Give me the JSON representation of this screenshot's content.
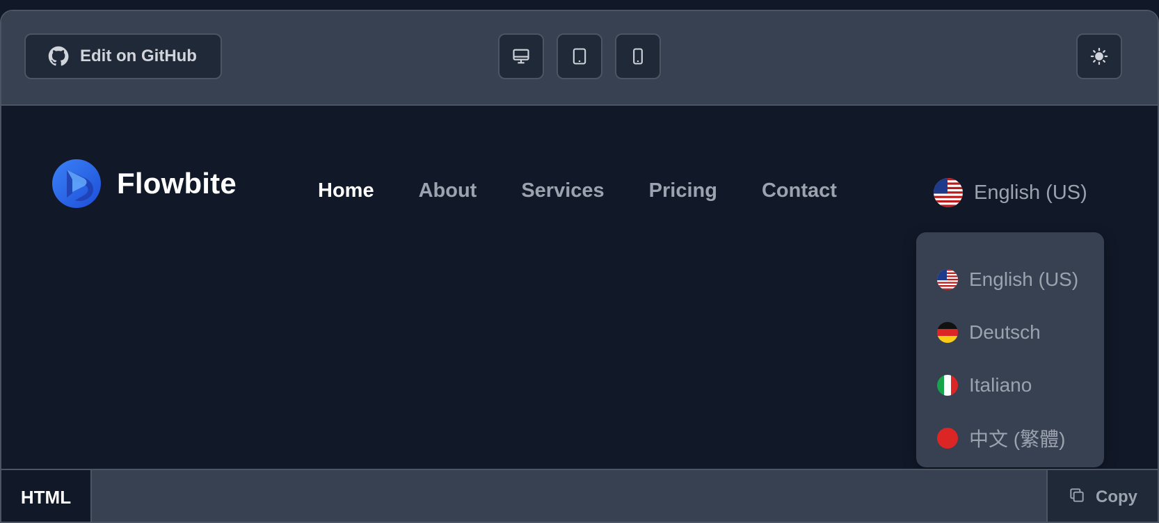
{
  "toolbar": {
    "github_label": "Edit on GitHub",
    "icons": {
      "github": "github-icon",
      "desktop": "desktop-icon",
      "tablet": "tablet-icon",
      "mobile": "mobile-icon",
      "theme": "sun-icon"
    }
  },
  "navbar": {
    "brand": "Flowbite",
    "links": [
      {
        "label": "Home",
        "active": true
      },
      {
        "label": "About",
        "active": false
      },
      {
        "label": "Services",
        "active": false
      },
      {
        "label": "Pricing",
        "active": false
      },
      {
        "label": "Contact",
        "active": false
      }
    ],
    "language": {
      "selected": "English (US)",
      "selected_flag": "us-flag",
      "options": [
        {
          "label": "English (US)",
          "flag": "us-flag"
        },
        {
          "label": "Deutsch",
          "flag": "de-flag"
        },
        {
          "label": "Italiano",
          "flag": "it-flag"
        },
        {
          "label": "中文 (繁體)",
          "flag": "cn-flag"
        }
      ]
    }
  },
  "footer": {
    "tab_label": "HTML",
    "copy_label": "Copy",
    "copy_icon": "copy-icon"
  },
  "colors": {
    "page_bg": "#111827",
    "toolbar_bg": "#374151",
    "button_bg": "#1f2937",
    "border": "#4b5563",
    "text_muted": "#9ca3af",
    "text_active": "#ffffff",
    "brand_blue": "#1d4ed8"
  }
}
